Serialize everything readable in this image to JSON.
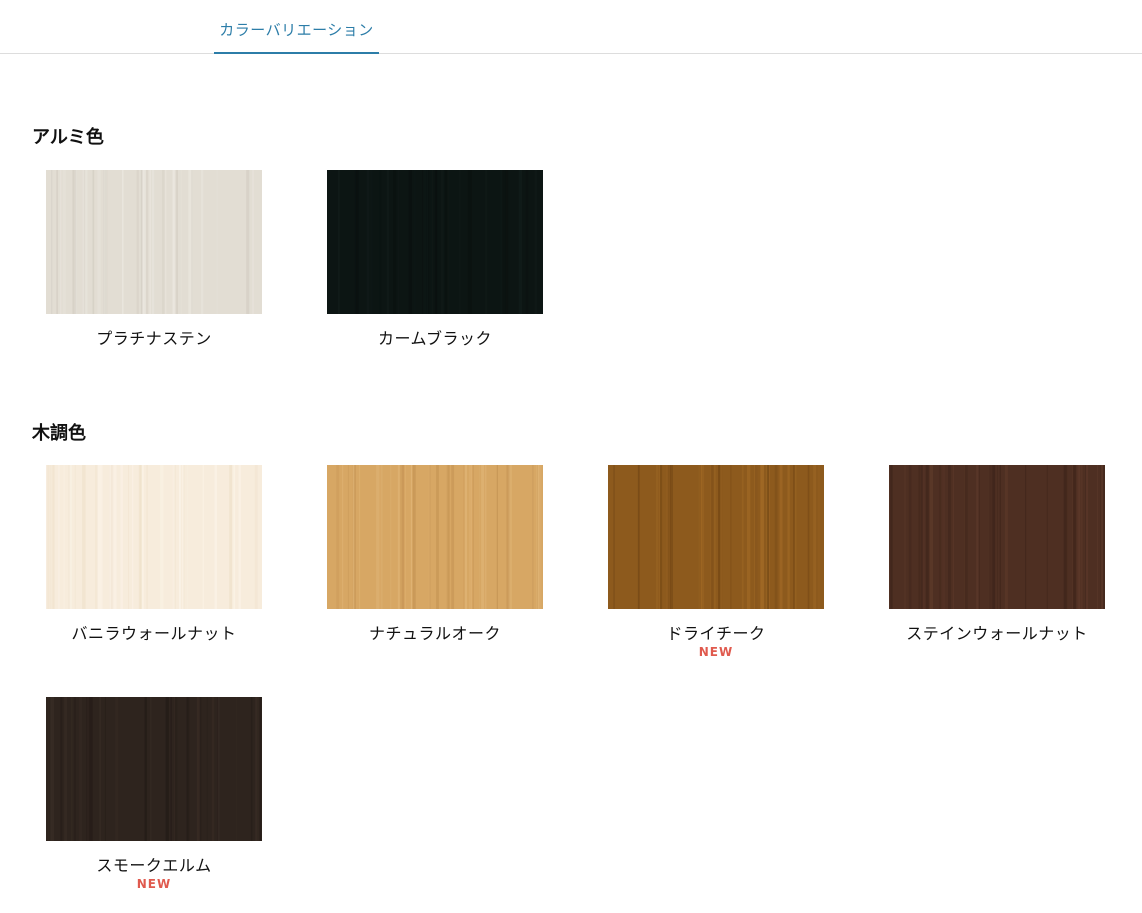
{
  "tabs": {
    "active_label": "カラーバリエーション",
    "accent_color": "#2c7da8"
  },
  "sections": [
    {
      "title": "アルミ色",
      "items": [
        {
          "name": "プラチナステン",
          "badge": "",
          "swatch": {
            "base": "#e2ddd3",
            "grain": "#cfc9be",
            "highlight": "#ece8e1"
          }
        },
        {
          "name": "カームブラック",
          "badge": "",
          "swatch": {
            "base": "#0c1513",
            "grain": "#0a100f",
            "highlight": "#121c1a"
          }
        }
      ]
    },
    {
      "title": "木調色",
      "items": [
        {
          "name": "バニラウォールナット",
          "badge": "",
          "swatch": {
            "base": "#f7ecdc",
            "grain": "#eedfc8",
            "highlight": "#fcf5ea"
          }
        },
        {
          "name": "ナチュラルオーク",
          "badge": "",
          "swatch": {
            "base": "#d7a764",
            "grain": "#c39252",
            "highlight": "#e2b87a"
          }
        },
        {
          "name": "ドライチーク",
          "badge": "NEW",
          "swatch": {
            "base": "#8d5a1d",
            "grain": "#6e4313",
            "highlight": "#a66d28"
          }
        },
        {
          "name": "ステインウォールナット",
          "badge": "",
          "swatch": {
            "base": "#4e2f22",
            "grain": "#3c2319",
            "highlight": "#5f3b2b"
          }
        },
        {
          "name": "スモークエルム",
          "badge": "NEW",
          "swatch": {
            "base": "#2e241e",
            "grain": "#221a16",
            "highlight": "#3a2e26"
          }
        }
      ]
    }
  ],
  "colors": {
    "badge_new": "#e05a4e",
    "divider": "#dddddd"
  }
}
